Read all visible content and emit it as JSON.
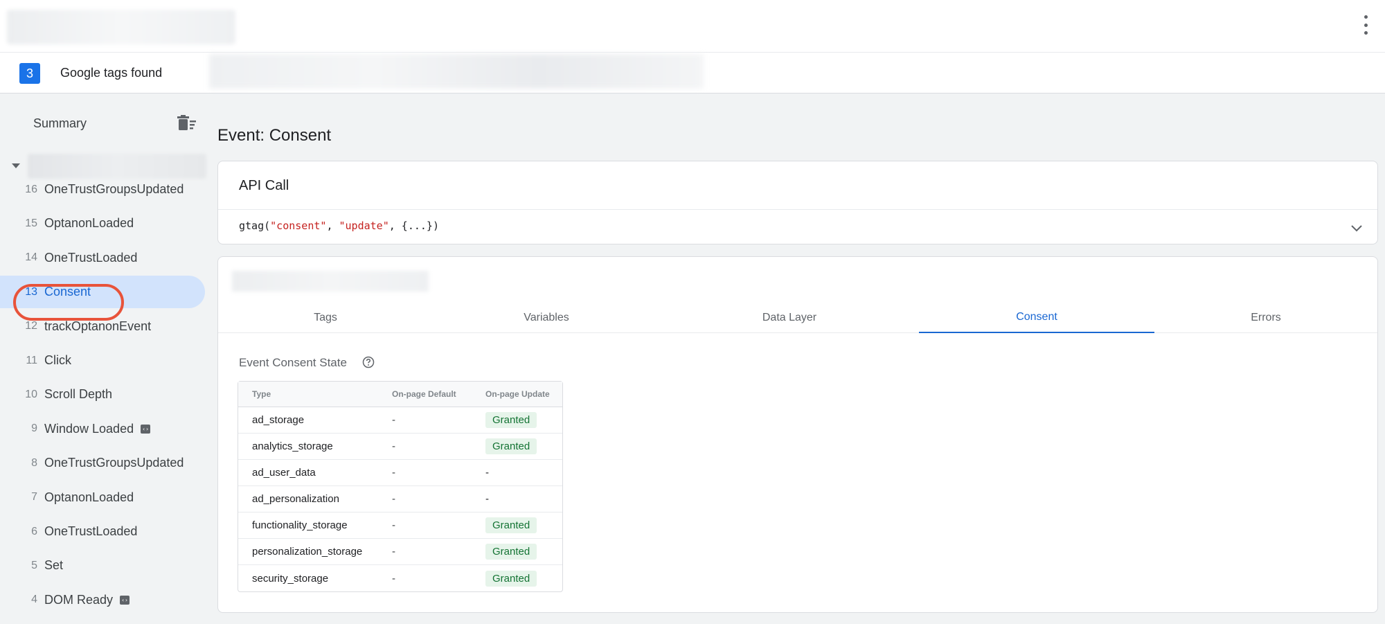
{
  "header": {
    "tag_count": "3",
    "tags_found_label": "Google tags found"
  },
  "sidebar": {
    "summary_label": "Summary",
    "events": [
      {
        "num": "16",
        "label": "OneTrustGroupsUpdated",
        "icon": false
      },
      {
        "num": "15",
        "label": "OptanonLoaded",
        "icon": false
      },
      {
        "num": "14",
        "label": "OneTrustLoaded",
        "icon": false
      },
      {
        "num": "13",
        "label": "Consent",
        "icon": false,
        "selected": true
      },
      {
        "num": "12",
        "label": "trackOptanonEvent",
        "icon": false
      },
      {
        "num": "11",
        "label": "Click",
        "icon": false
      },
      {
        "num": "10",
        "label": "Scroll Depth",
        "icon": false
      },
      {
        "num": "9",
        "label": "Window Loaded",
        "icon": true
      },
      {
        "num": "8",
        "label": "OneTrustGroupsUpdated",
        "icon": false
      },
      {
        "num": "7",
        "label": "OptanonLoaded",
        "icon": false
      },
      {
        "num": "6",
        "label": "OneTrustLoaded",
        "icon": false
      },
      {
        "num": "5",
        "label": "Set",
        "icon": false
      },
      {
        "num": "4",
        "label": "DOM Ready",
        "icon": true
      }
    ]
  },
  "main": {
    "event_title": "Event: Consent",
    "api": {
      "title": "API Call",
      "code_prefix": "gtag(",
      "arg1": "\"consent\"",
      "sep1": ", ",
      "arg2": "\"update\"",
      "code_suffix": ", {...})"
    },
    "tabs": [
      "Tags",
      "Variables",
      "Data Layer",
      "Consent",
      "Errors"
    ],
    "active_tab": "Consent",
    "consent": {
      "title": "Event Consent State",
      "headers": [
        "Type",
        "On-page Default",
        "On-page Update"
      ],
      "rows": [
        {
          "type": "ad_storage",
          "default": "-",
          "update": "Granted"
        },
        {
          "type": "analytics_storage",
          "default": "-",
          "update": "Granted"
        },
        {
          "type": "ad_user_data",
          "default": "-",
          "update": "-"
        },
        {
          "type": "ad_personalization",
          "default": "-",
          "update": "-"
        },
        {
          "type": "functionality_storage",
          "default": "-",
          "update": "Granted"
        },
        {
          "type": "personalization_storage",
          "default": "-",
          "update": "Granted"
        },
        {
          "type": "security_storage",
          "default": "-",
          "update": "Granted"
        }
      ]
    }
  },
  "colors": {
    "accent": "#1a73e8",
    "highlight": "#e8533a",
    "granted_bg": "#e6f4ea",
    "granted_text": "#137333"
  }
}
